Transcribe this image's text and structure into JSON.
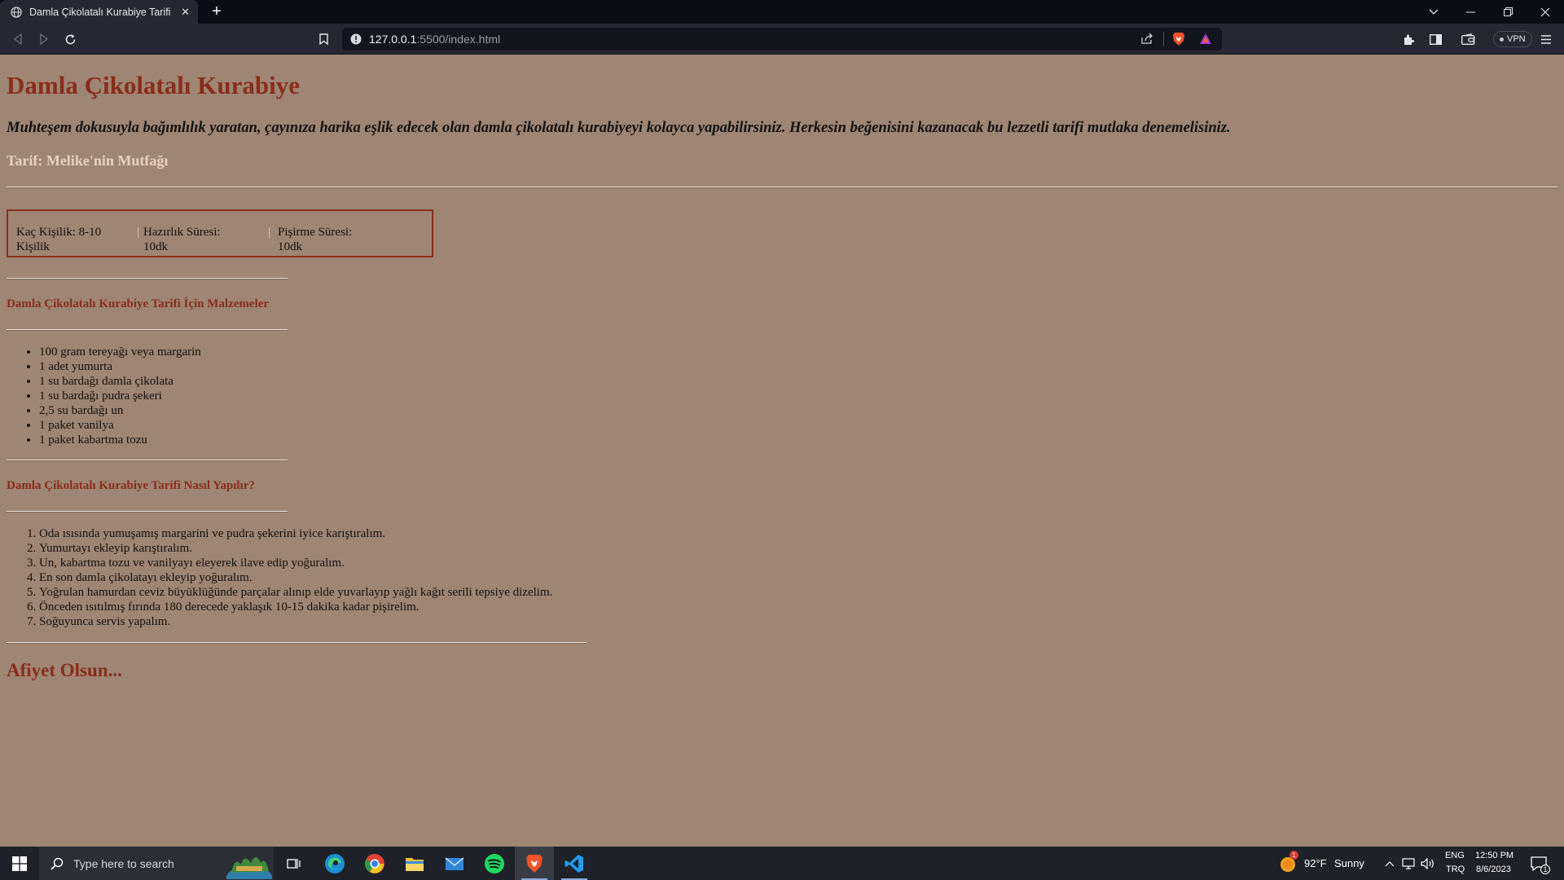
{
  "browser": {
    "tab_title": "Damla Çikolatalı Kurabiye Tarifi",
    "url_host": "127.0.0.1",
    "url_rest": ":5500/index.html",
    "vpn_label": "VPN"
  },
  "page": {
    "title": "Damla Çikolatalı Kurabiye",
    "intro": "Muhteşem dokusuyla bağımlılık yaratan, çayınıza harika eşlik edecek olan damla çikolatalı kurabiyeyi kolayca yapabilirsiniz. Herkesin beğenisini kazanacak bu lezzetli tarifi mutlaka denemelisiniz.",
    "author": "Tarif: Melike'nin Mutfağı",
    "info": {
      "servings_line1": "Kaç Kişilik: 8-10",
      "servings_line2": "Kişilik",
      "prep_line1": "Hazırlık Süresi:",
      "prep_line2": "10dk",
      "cook_line1": "Pişirme Süresi:",
      "cook_line2": "10dk"
    },
    "ingredients_heading": "Damla Çikolatalı Kurabiye Tarifi İçin Malzemeler",
    "ingredients": [
      "100 gram tereyağı veya margarin",
      "1 adet yumurta",
      "1 su bardağı damla çikolata",
      "1 su bardağı pudra şekeri",
      "2,5 su bardağı un",
      "1 paket vanilya",
      "1 paket kabartma tozu"
    ],
    "steps_heading": "Damla Çikolatalı Kurabiye Tarifi Nasıl Yapılır?",
    "steps": [
      "Oda ısısında yumuşamış margarini ve pudra şekerini iyice karıştıralım.",
      "Yumurtayı ekleyip karıştıralım.",
      "Un, kabartma tozu ve vanilyayı eleyerek ilave edip yoğuralım.",
      "En son damla çikolatayı ekleyip yoğuralım.",
      "Yoğrulan hamurdan ceviz büyüklüğünde parçalar alınıp elde yuvarlayıp yağlı kağıt serili tepsiye dizelim.",
      "Önceden ısıtılmış fırında 180 derecede yaklaşık 10-15 dakika kadar pişirelim.",
      "Soğuyunca servis yapalım."
    ],
    "closing": "Afiyet Olsun..."
  },
  "taskbar": {
    "search_placeholder": "Type here to search",
    "weather_temp": "92°F",
    "weather_desc": "Sunny",
    "weather_badge": "1",
    "lang_line1": "ENG",
    "lang_line2": "TRQ",
    "time": "12:50 PM",
    "date": "8/6/2023",
    "notification_count": "1"
  }
}
